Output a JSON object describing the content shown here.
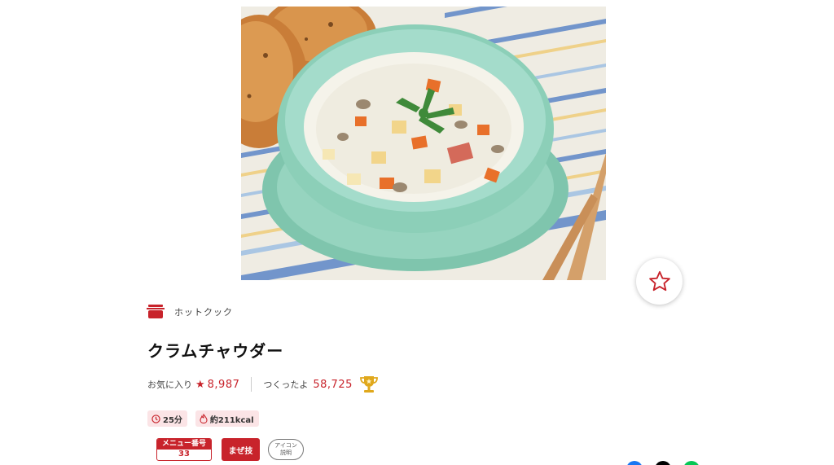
{
  "recipe": {
    "image_alt": "クラムチャウダー",
    "category": "ホットクック",
    "title": "クラムチャウダー",
    "favorites_label": "お気に入り",
    "favorites_count": "8,987",
    "made_label": "つくったよ",
    "made_count": "58,725",
    "time": "25分",
    "calories": "約211kcal",
    "menu_number_label": "メニュー番号",
    "menu_number": "33",
    "maze_label": "まぜ技",
    "icon_help_line1": "アイコン",
    "icon_help_line2": "説明"
  },
  "colors": {
    "accent": "#c8232b",
    "chip_bg": "#fbe4e6",
    "trophy": "#e0a81c"
  },
  "icons": {
    "favorite_button": "star-outline-icon",
    "category": "pot-icon",
    "trophy": "trophy-icon",
    "time": "clock-icon",
    "calories": "flame-icon",
    "share": [
      "facebook-icon",
      "x-icon",
      "line-icon"
    ]
  }
}
